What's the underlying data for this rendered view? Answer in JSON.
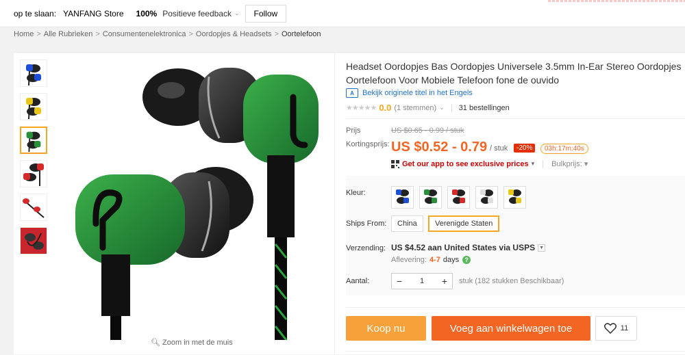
{
  "topbar": {
    "store_label": "op te slaan:",
    "store_name": "YANFANG Store",
    "rating": "100%",
    "feedback": "Positieve feedback",
    "follow": "Follow"
  },
  "breadcrumb": [
    "Home",
    "Alle Rubrieken",
    "Consumentenelektronica",
    "Oordopjes & Headsets",
    "Oortelefoon"
  ],
  "gallery": {
    "zoom_hint": "Zoom in met de muis",
    "thumbs": [
      "blue",
      "yellow",
      "green",
      "red",
      "red-white",
      "red-background"
    ]
  },
  "product": {
    "title": "Headset Oordopjes Bas Oordopjes Universele 3.5mm In-Ear Stereo Oordopjes Oortelefoon Voor Mobiele Telefoon fone de ouvido",
    "translate_icon": "translate-icon",
    "translate_text": "Bekijk originele titel in het Engels",
    "stars": "★★★★★",
    "rating_value": "0.0",
    "votes": "(1 stemmen)",
    "orders": "31 bestellingen",
    "price_label": "Prijs",
    "original_price": "US $0.65 - 0.99 / stuk",
    "discount_label": "Kortingsprijs:",
    "sale_price": "US $0.52 - 0.79",
    "per_unit": "/ stuk",
    "discount": "-20%",
    "timer": "03h:17m:40s",
    "app_text": "Get our app to see exclusive prices",
    "bulk": "Bulkprijs:"
  },
  "options": {
    "color_label": "Kleur:",
    "colors": [
      "blue",
      "green",
      "red",
      "white",
      "yellow"
    ],
    "ships_label": "Ships From:",
    "ship_china": "China",
    "ship_us": "Verenigde Staten",
    "shipping_label": "Verzending:",
    "shipping_cost": "US $4.52",
    "shipping_rest": "aan United States via USPS",
    "delivery_label": "Aflevering:",
    "delivery_days": "4-7",
    "delivery_unit": "days",
    "quantity_label": "Aantal:",
    "quantity_value": "1",
    "stock": "stuk (182 stukken Beschikbaar)"
  },
  "actions": {
    "buy_now": "Koop nu",
    "add_to_cart": "Voeg aan winkelwagen toe",
    "wishlist_count": "11"
  },
  "colors": {
    "orange": "#f26522",
    "light_orange": "#f7a13a",
    "link_blue": "#2272c8",
    "green": "#2a8f3a"
  }
}
